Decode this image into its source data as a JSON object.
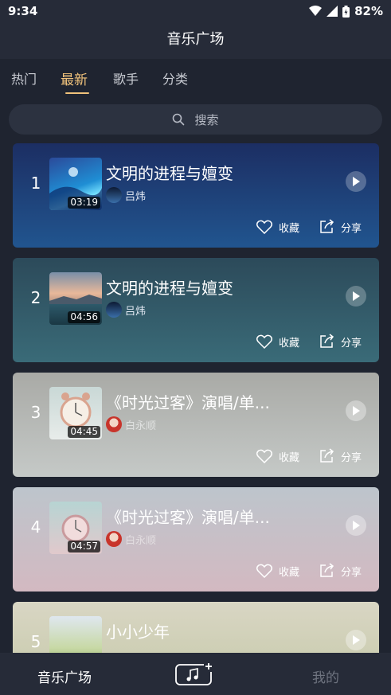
{
  "status": {
    "time": "9:34",
    "battery": "82%"
  },
  "app": {
    "title": "音乐广场"
  },
  "tabs": [
    {
      "label": "热门"
    },
    {
      "label": "最新"
    },
    {
      "label": "歌手"
    },
    {
      "label": "分类"
    }
  ],
  "search": {
    "placeholder": "搜索"
  },
  "songs": [
    {
      "index": "1",
      "title": "文明的进程与嬗变",
      "artist": "吕炜",
      "duration": "03:19",
      "collect": "收藏",
      "share": "分享"
    },
    {
      "index": "2",
      "title": "文明的进程与嬗变",
      "artist": "吕炜",
      "duration": "04:56",
      "collect": "收藏",
      "share": "分享"
    },
    {
      "index": "3",
      "title": "《时光过客》演唱/单...",
      "artist": "白永顺",
      "duration": "04:45",
      "collect": "收藏",
      "share": "分享"
    },
    {
      "index": "4",
      "title": "《时光过客》演唱/单...",
      "artist": "白永顺",
      "duration": "04:57",
      "collect": "收藏",
      "share": "分享"
    },
    {
      "index": "5",
      "title": "小小少年",
      "artist": "",
      "duration": "",
      "collect": "",
      "share": ""
    }
  ],
  "bottom_nav": {
    "left": "音乐广场",
    "center_icon": "add-music-icon",
    "right": "我的"
  }
}
